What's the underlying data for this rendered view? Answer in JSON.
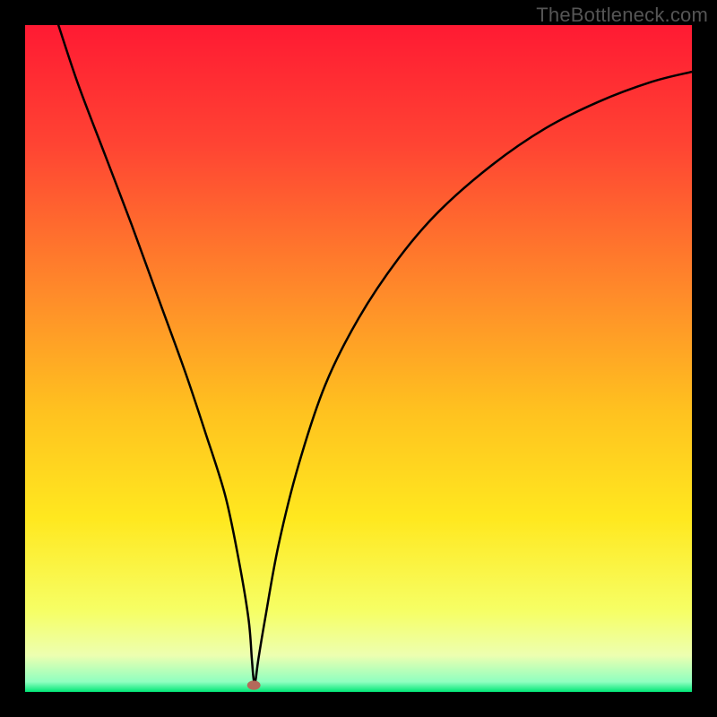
{
  "watermark": "TheBottleneck.com",
  "chart_data": {
    "type": "line",
    "title": "",
    "xlabel": "",
    "ylabel": "",
    "xlim": [
      0,
      100
    ],
    "ylim": [
      0,
      100
    ],
    "grid": false,
    "legend": false,
    "background_gradient": {
      "stops": [
        {
          "offset": 0.0,
          "color": "#ff1a33"
        },
        {
          "offset": 0.18,
          "color": "#ff4433"
        },
        {
          "offset": 0.4,
          "color": "#ff8a2a"
        },
        {
          "offset": 0.58,
          "color": "#ffc21f"
        },
        {
          "offset": 0.74,
          "color": "#ffe81f"
        },
        {
          "offset": 0.88,
          "color": "#f6ff66"
        },
        {
          "offset": 0.945,
          "color": "#edffb0"
        },
        {
          "offset": 0.985,
          "color": "#8fffc0"
        },
        {
          "offset": 1.0,
          "color": "#00e676"
        }
      ]
    },
    "series": [
      {
        "name": "bottleneck-curve",
        "x": [
          5,
          8,
          12,
          16,
          20,
          24,
          27,
          30,
          32,
          33.5,
          34,
          34.2,
          34.4,
          34.6,
          35,
          36,
          38,
          41,
          45,
          50,
          56,
          62,
          70,
          78,
          86,
          94,
          100
        ],
        "y": [
          100,
          91,
          80.5,
          70,
          59,
          48,
          39,
          29.5,
          20,
          11,
          5,
          2.5,
          1.2,
          2.0,
          5,
          11,
          22,
          34,
          46,
          56,
          65,
          72,
          79,
          84.5,
          88.5,
          91.5,
          93
        ]
      }
    ],
    "marker": {
      "name": "optimal-point",
      "x": 34.3,
      "y": 1.0,
      "rx": 1.0,
      "ry": 0.7,
      "color": "#b46a5a"
    }
  }
}
